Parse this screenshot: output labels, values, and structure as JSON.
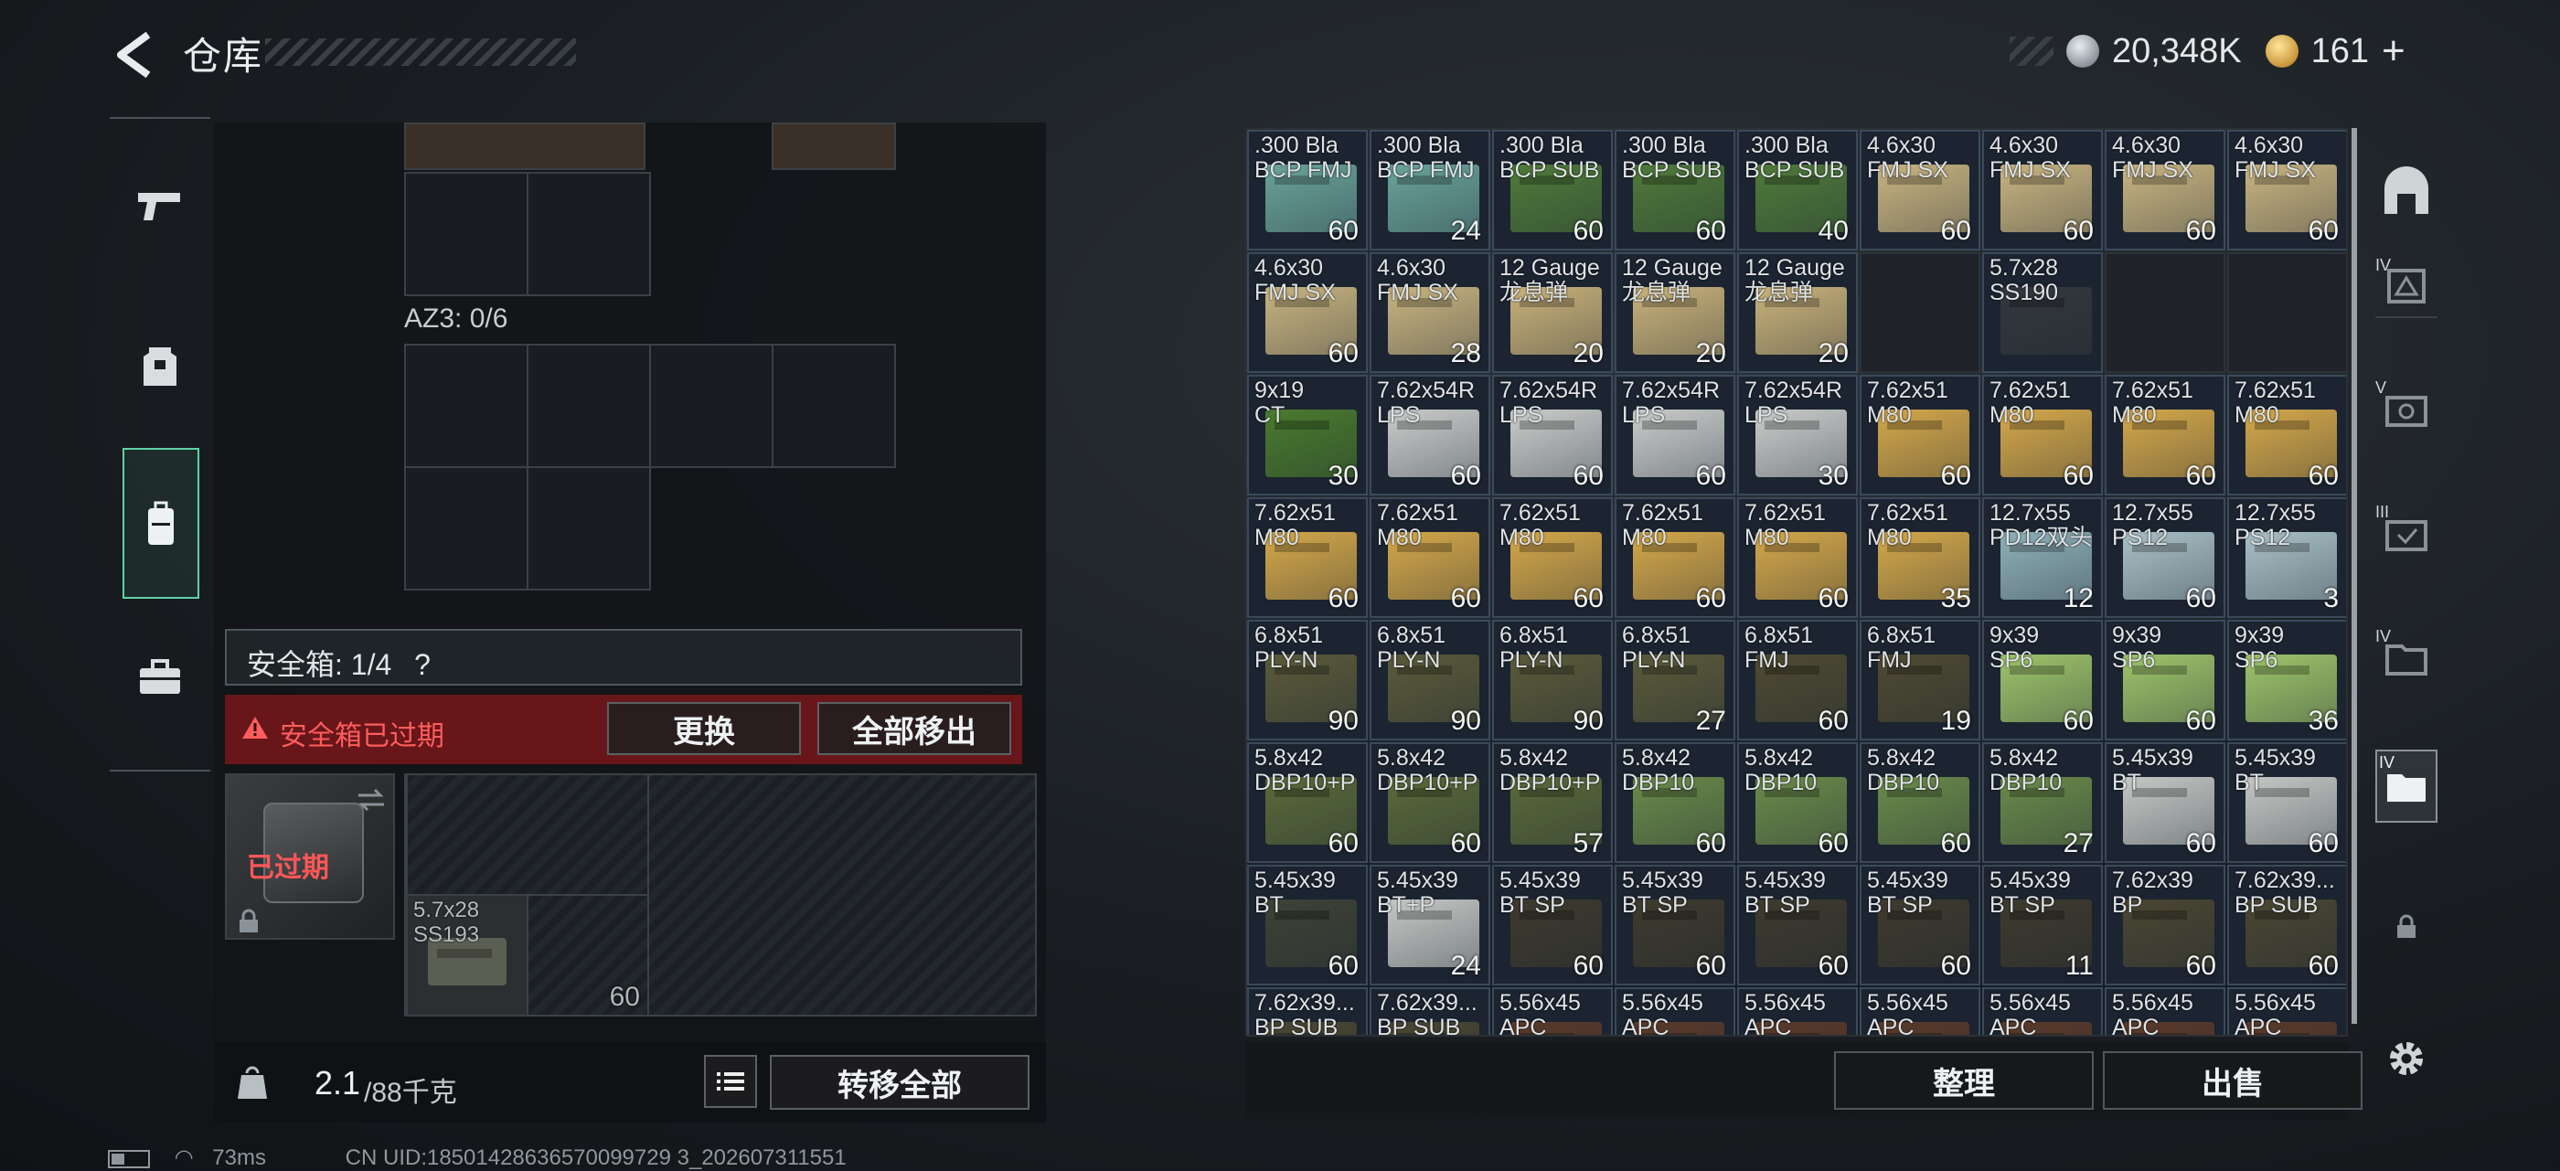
{
  "header": {
    "title": "仓库",
    "silver": "20,348K",
    "gold": "161",
    "plus": "+"
  },
  "left": {
    "az3_label": "AZ3: 0/6",
    "safebox_label": "安全箱: 1/4",
    "help": "?",
    "warning": "安全箱已过期",
    "replace": "更换",
    "remove_all": "全部移出",
    "expired": "已过期",
    "item_name": "5.7x28\nSS193",
    "item_qty": "60",
    "weight_current": "2.1",
    "weight_max": "/88千克",
    "transfer_all": "转移全部",
    "kg": "KG"
  },
  "grid": {
    "rows": [
      [
        {
          "n": ".300 Bla\nBCP FMJ",
          "q": "60",
          "c": "#6aa39a"
        },
        {
          "n": ".300 Bla\nBCP FMJ",
          "q": "24",
          "c": "#6aa39a"
        },
        {
          "n": ".300 Bla\nBCP SUB",
          "q": "60",
          "c": "#4f7a3a"
        },
        {
          "n": ".300 Bla\nBCP SUB",
          "q": "60",
          "c": "#4f7a3a"
        },
        {
          "n": ".300 Bla\nBCP SUB",
          "q": "40",
          "c": "#4f7a3a"
        },
        {
          "n": "4.6x30\nFMJ SX",
          "q": "60",
          "c": "#c8b480"
        },
        {
          "n": "4.6x30\nFMJ SX",
          "q": "60",
          "c": "#c8b480"
        },
        {
          "n": "4.6x30\nFMJ SX",
          "q": "60",
          "c": "#c8b480"
        },
        {
          "n": "4.6x30\nFMJ SX",
          "q": "60",
          "c": "#c8b480"
        }
      ],
      [
        {
          "n": "4.6x30\nFMJ SX",
          "q": "60",
          "c": "#c8b480"
        },
        {
          "n": "4.6x30\nFMJ SX",
          "q": "28",
          "c": "#c8b480"
        },
        {
          "n": "12 Gauge\n龙息弹",
          "q": "20",
          "c": "#c9b27a"
        },
        {
          "n": "12 Gauge\n龙息弹",
          "q": "20",
          "c": "#c9b27a"
        },
        {
          "n": "12 Gauge\n龙息弹",
          "q": "20",
          "c": "#c9b27a"
        },
        {
          "e": true
        },
        {
          "n": "5.7x28\nSS190",
          "q": "",
          "c": "#33383c"
        },
        {
          "e": true
        },
        {
          "e": true
        }
      ],
      [
        {
          "n": "9x19\nCT",
          "q": "30",
          "c": "#4a7a2e"
        },
        {
          "n": "7.62x54R\nLPS",
          "q": "60",
          "c": "#c9ccca"
        },
        {
          "n": "7.62x54R\nLPS",
          "q": "60",
          "c": "#c9ccca"
        },
        {
          "n": "7.62x54R\nLPS",
          "q": "60",
          "c": "#c9ccca"
        },
        {
          "n": "7.62x54R\nLPS",
          "q": "30",
          "c": "#c9ccca"
        },
        {
          "n": "7.62x51\nM80",
          "q": "60",
          "c": "#d4a84a"
        },
        {
          "n": "7.62x51\nM80",
          "q": "60",
          "c": "#d4a84a"
        },
        {
          "n": "7.62x51\nM80",
          "q": "60",
          "c": "#d4a84a"
        },
        {
          "n": "7.62x51\nM80",
          "q": "60",
          "c": "#d4a84a"
        }
      ],
      [
        {
          "n": "7.62x51\nM80",
          "q": "60",
          "c": "#d4a84a"
        },
        {
          "n": "7.62x51\nM80",
          "q": "60",
          "c": "#d4a84a"
        },
        {
          "n": "7.62x51\nM80",
          "q": "60",
          "c": "#d4a84a"
        },
        {
          "n": "7.62x51\nM80",
          "q": "60",
          "c": "#d4a84a"
        },
        {
          "n": "7.62x51\nM80",
          "q": "60",
          "c": "#d4a84a"
        },
        {
          "n": "7.62x51\nM80",
          "q": "35",
          "c": "#d4a84a"
        },
        {
          "n": "12.7x55\nPD12双头",
          "q": "12",
          "c": "#8fb0b8"
        },
        {
          "n": "12.7x55\nPS12",
          "q": "60",
          "c": "#a9c0c6"
        },
        {
          "n": "12.7x55\nPS12",
          "q": "3",
          "c": "#a9c0c6"
        }
      ],
      [
        {
          "n": "6.8x51\nPLY-N",
          "q": "90",
          "c": "#5a5a3a"
        },
        {
          "n": "6.8x51\nPLY-N",
          "q": "90",
          "c": "#5a5a3a"
        },
        {
          "n": "6.8x51\nPLY-N",
          "q": "90",
          "c": "#5a5a3a"
        },
        {
          "n": "6.8x51\nPLY-N",
          "q": "27",
          "c": "#5a5a3a"
        },
        {
          "n": "6.8x51\nFMJ",
          "q": "60",
          "c": "#4e4a32"
        },
        {
          "n": "6.8x51\nFMJ",
          "q": "19",
          "c": "#4e4a32"
        },
        {
          "n": "9x39\nSP6",
          "q": "60",
          "c": "#9ec46a"
        },
        {
          "n": "9x39\nSP6",
          "q": "60",
          "c": "#9ec46a"
        },
        {
          "n": "9x39\nSP6",
          "q": "36",
          "c": "#9ec46a"
        }
      ],
      [
        {
          "n": "5.8x42\nDBP10+P",
          "q": "60",
          "c": "#5a6a3a"
        },
        {
          "n": "5.8x42\nDBP10+P",
          "q": "60",
          "c": "#5a6a3a"
        },
        {
          "n": "5.8x42\nDBP10+P",
          "q": "57",
          "c": "#5a6a3a"
        },
        {
          "n": "5.8x42\nDBP10",
          "q": "60",
          "c": "#6a8a4a"
        },
        {
          "n": "5.8x42\nDBP10",
          "q": "60",
          "c": "#6a8a4a"
        },
        {
          "n": "5.8x42\nDBP10",
          "q": "60",
          "c": "#6a8a4a"
        },
        {
          "n": "5.8x42\nDBP10",
          "q": "27",
          "c": "#6a8a4a"
        },
        {
          "n": "5.45x39\nBT",
          "q": "60",
          "c": "#c4c7c4"
        },
        {
          "n": "5.45x39\nBT",
          "q": "60",
          "c": "#c4c7c4"
        }
      ],
      [
        {
          "n": "5.45x39\nBT",
          "q": "60",
          "c": "#3e4236"
        },
        {
          "n": "5.45x39\nBT+P",
          "q": "24",
          "c": "#c4c7c4"
        },
        {
          "n": "5.45x39\nBT SP",
          "q": "60",
          "c": "#3e3a2e"
        },
        {
          "n": "5.45x39\nBT SP",
          "q": "60",
          "c": "#3e3a2e"
        },
        {
          "n": "5.45x39\nBT SP",
          "q": "60",
          "c": "#3e3a2e"
        },
        {
          "n": "5.45x39\nBT SP",
          "q": "60",
          "c": "#3e3a2e"
        },
        {
          "n": "5.45x39\nBT SP",
          "q": "11",
          "c": "#3e3a2e"
        },
        {
          "n": "7.62x39\nBP",
          "q": "60",
          "c": "#4a4632"
        },
        {
          "n": "7.62x39...\nBP SUB",
          "q": "60",
          "c": "#4a4632"
        }
      ],
      [
        {
          "n": "7.62x39...\nBP SUB",
          "q": "",
          "c": "#4a4632"
        },
        {
          "n": "7.62x39...\nBP SUB",
          "q": "",
          "c": "#4a4632"
        },
        {
          "n": "5.56x45\nAPC",
          "q": "",
          "c": "#5a3a2a"
        },
        {
          "n": "5.56x45\nAPC",
          "q": "",
          "c": "#5a3a2a"
        },
        {
          "n": "5.56x45\nAPC",
          "q": "",
          "c": "#5a3a2a"
        },
        {
          "n": "5.56x45\nAPC",
          "q": "",
          "c": "#5a3a2a"
        },
        {
          "n": "5.56x45\nAPC",
          "q": "",
          "c": "#5a3a2a"
        },
        {
          "n": "5.56x45\nAPC",
          "q": "",
          "c": "#5a3a2a"
        },
        {
          "n": "5.56x45\nAPC",
          "q": "",
          "c": "#5a3a2a"
        }
      ]
    ]
  },
  "actions": {
    "sort": "整理",
    "sell": "出售"
  },
  "status": {
    "ping": "73ms",
    "uid": "CN UID:18501428636570099729 3_202607311551"
  },
  "right_rail": {
    "tier_labels": [
      "IV",
      "V",
      "III",
      "IV",
      "IV"
    ]
  },
  "icons": [
    "back-icon",
    "pistol-icon",
    "armor-icon",
    "backpack-icon",
    "case-icon",
    "helmet-icon",
    "lock-icon",
    "gear-icon",
    "list-icon",
    "warning-icon",
    "weight-icon",
    "swap-icon"
  ]
}
